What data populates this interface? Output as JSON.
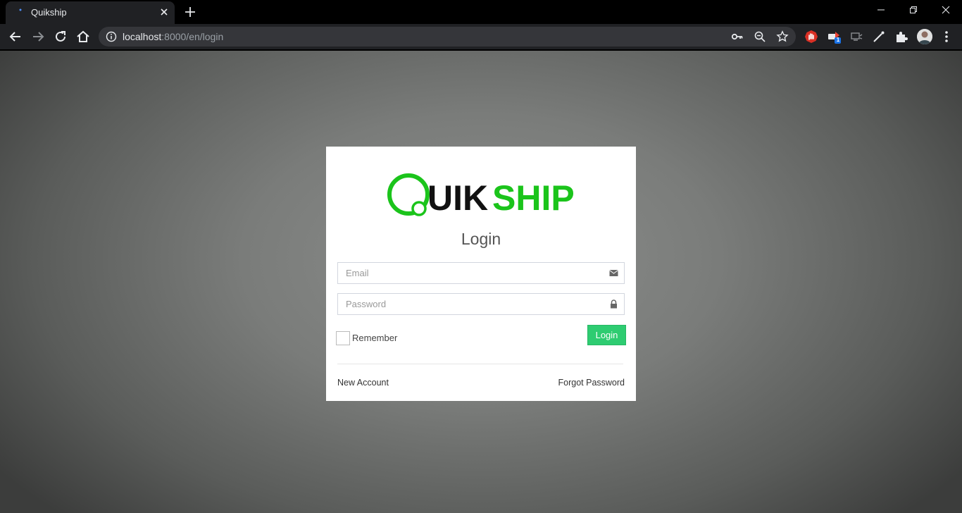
{
  "browser": {
    "tab_title": "Quikship",
    "url_host": "localhost",
    "url_path": ":8000/en/login",
    "icons": [
      "back-icon",
      "forward-icon",
      "reload-icon",
      "home-icon",
      "info-icon",
      "key-icon",
      "zoom-out-icon",
      "star-icon",
      "extensions-icon",
      "menu-icon"
    ],
    "extension_badge": "1"
  },
  "logo": {
    "prefix": "UIK",
    "suffix": "SHIP",
    "green": "#1bc41b",
    "dark": "#111111"
  },
  "login": {
    "title": "Login",
    "email_placeholder": "Email",
    "password_placeholder": "Password",
    "remember_label": "Remember",
    "button_label": "Login",
    "new_account": "New Account",
    "forgot_password": "Forgot Password",
    "accent_color": "#2ecc71"
  }
}
